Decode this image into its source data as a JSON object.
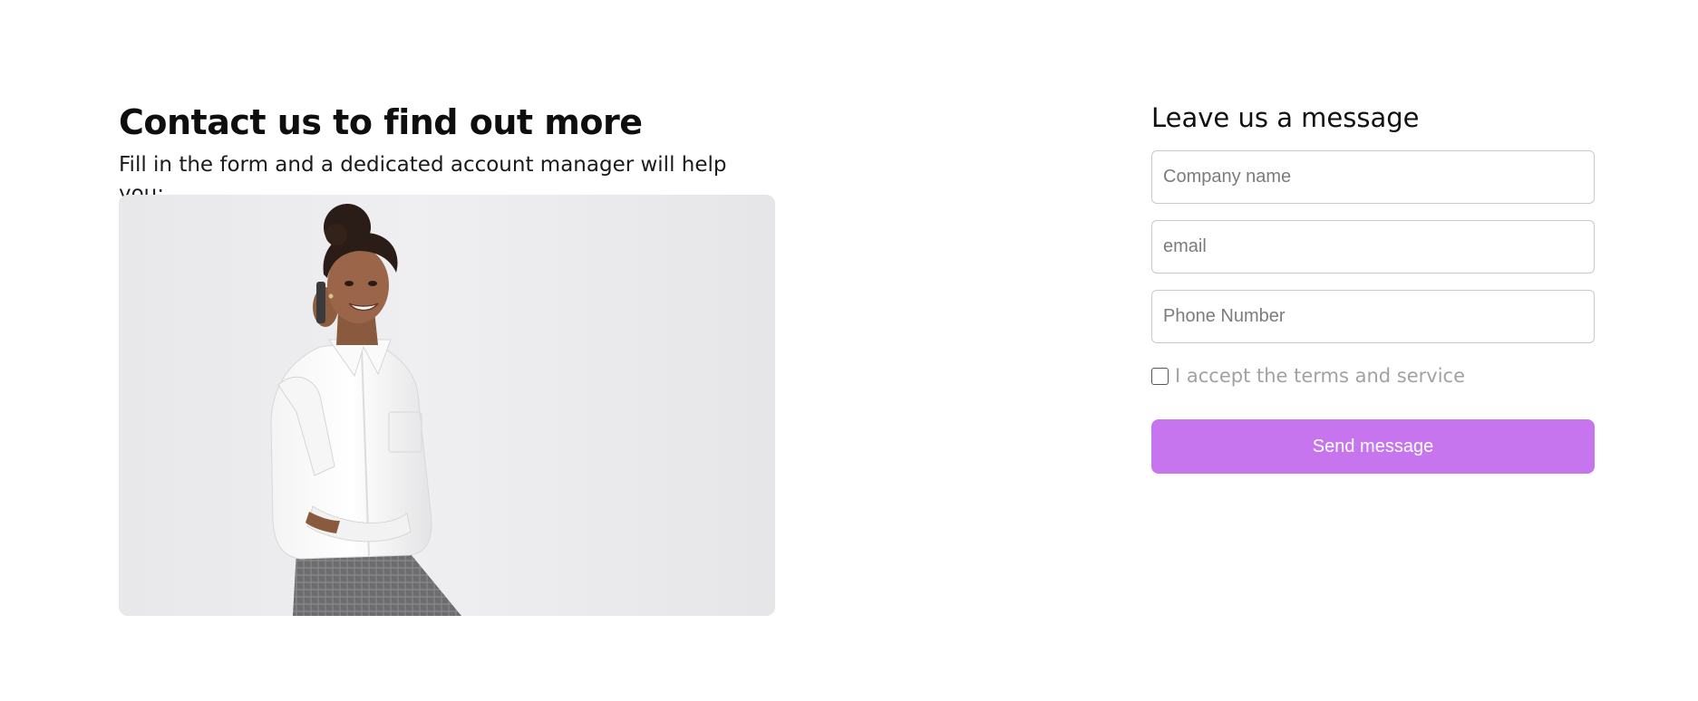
{
  "contact": {
    "heading": "Contact us to find out more",
    "subtitle": "Fill in the form and a dedicated account manager will help you:"
  },
  "form": {
    "title": "Leave us a message",
    "company_placeholder": "Company name",
    "email_placeholder": "email",
    "phone_placeholder": "Phone Number",
    "terms_label": "I accept the terms and service",
    "terms_checked": false,
    "send_label": "Send message"
  },
  "colors": {
    "accent": "#c775ee",
    "field_border": "#c9c9cc",
    "muted_text": "#a2a2a6"
  }
}
